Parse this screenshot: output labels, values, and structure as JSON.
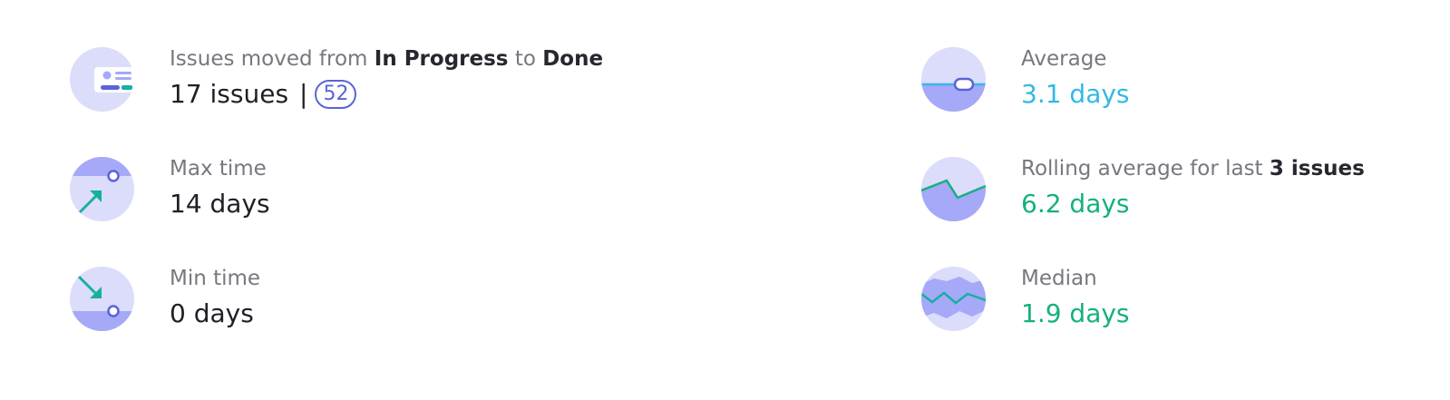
{
  "stats": {
    "issues": {
      "label_pre": "Issues moved from",
      "from_status": "In Progress",
      "label_mid": "to",
      "to_status": "Done",
      "value": "17 issues",
      "separator": "|",
      "badge": "52"
    },
    "max_time": {
      "label": "Max time",
      "value": "14 days"
    },
    "min_time": {
      "label": "Min time",
      "value": "0 days"
    },
    "average": {
      "label": "Average",
      "value": "3.1 days"
    },
    "rolling": {
      "label_pre": "Rolling average for last",
      "label_strong": "3 issues",
      "value": "6.2 days"
    },
    "median": {
      "label": "Median",
      "value": "1.9 days"
    }
  },
  "icons": {
    "issues": "issue-card-icon",
    "max_time": "trend-up-arrow-icon",
    "min_time": "trend-down-arrow-icon",
    "average": "average-line-icon",
    "rolling": "rolling-average-chart-icon",
    "median": "median-wave-icon"
  },
  "colors": {
    "icon_bg": "#dcdcfb",
    "icon_accent": "#a6a8f8",
    "indigo": "#5a64d8",
    "teal": "#16b0a0",
    "blue_value": "#34b8e8",
    "green_value": "#16b07f"
  }
}
